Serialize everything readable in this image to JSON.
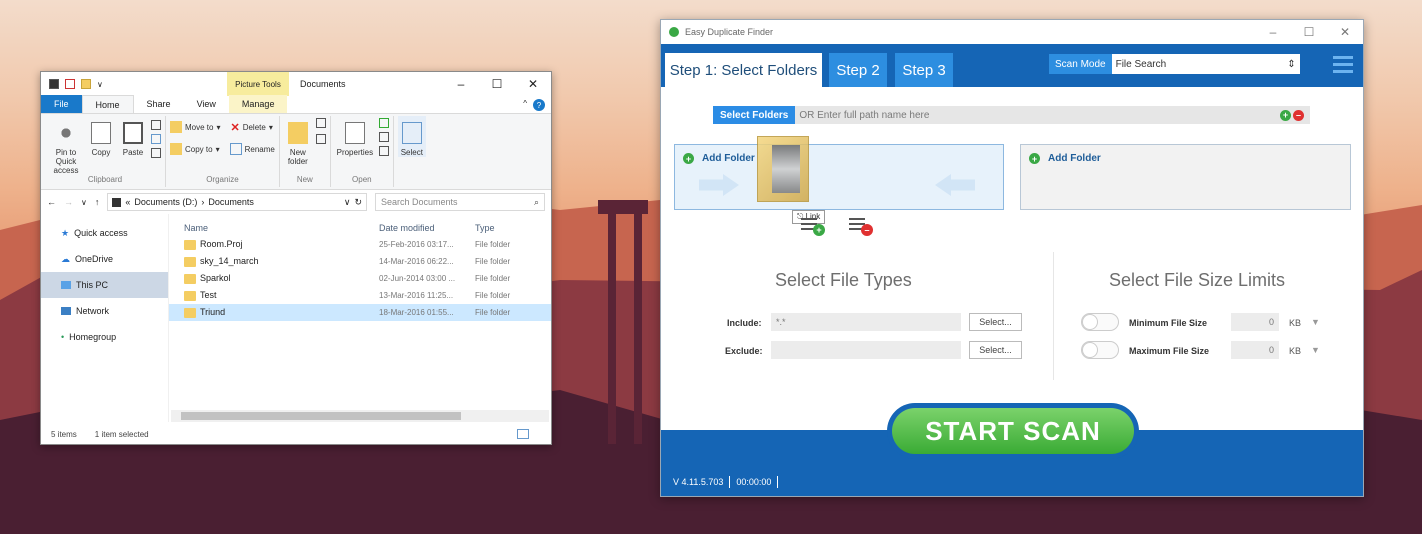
{
  "explorer": {
    "contextual_tab": "Picture Tools",
    "title": "Documents",
    "tabs": [
      "File",
      "Home",
      "Share",
      "View",
      "Manage"
    ],
    "ribbon": {
      "clipboard": {
        "label": "Clipboard",
        "pin": "Pin to Quick access",
        "copy": "Copy",
        "paste": "Paste"
      },
      "organize": {
        "label": "Organize",
        "move_to": "Move to",
        "copy_to": "Copy to",
        "delete": "Delete",
        "rename": "Rename"
      },
      "new": {
        "label": "New",
        "new_folder": "New folder"
      },
      "open": {
        "label": "Open",
        "properties": "Properties"
      },
      "select": {
        "select": "Select"
      }
    },
    "address": {
      "path_root": "Documents (D:)",
      "path_leaf": "Documents",
      "search_placeholder": "Search Documents"
    },
    "nav": [
      "Quick access",
      "OneDrive",
      "This PC",
      "Network",
      "Homegroup"
    ],
    "columns": [
      "Name",
      "Date modified",
      "Type"
    ],
    "files": [
      {
        "name": "Room.Proj",
        "date": "25-Feb-2016 03:17...",
        "type": "File folder"
      },
      {
        "name": "sky_14_march",
        "date": "14-Mar-2016 06:22...",
        "type": "File folder"
      },
      {
        "name": "Sparkol",
        "date": "02-Jun-2014 03:00 ...",
        "type": "File folder"
      },
      {
        "name": "Test",
        "date": "13-Mar-2016 11:25...",
        "type": "File folder"
      },
      {
        "name": "Triund",
        "date": "18-Mar-2016 01:55...",
        "type": "File folder"
      }
    ],
    "status": {
      "count": "5 items",
      "selection": "1 item selected"
    }
  },
  "edf": {
    "title": "Easy Duplicate Finder",
    "steps": [
      "Step 1: Select Folders",
      "Step 2",
      "Step 3"
    ],
    "scan_mode_label": "Scan Mode",
    "scan_mode_value": "File Search",
    "select_folders_label": "Select Folders",
    "path_placeholder": "OR Enter full path name here",
    "add_folder": "Add Folder",
    "drag_tip": "Link",
    "file_types_title": "Select File Types",
    "include_label": "Include:",
    "include_value": "*.*",
    "exclude_label": "Exclude:",
    "select_btn": "Select...",
    "size_title": "Select File Size Limits",
    "min_label": "Minimum File Size",
    "max_label": "Maximum File Size",
    "min_value": "0",
    "max_value": "0",
    "unit": "KB",
    "start_scan": "START SCAN",
    "version": "V 4.11.5.703",
    "timer": "00:00:00"
  }
}
